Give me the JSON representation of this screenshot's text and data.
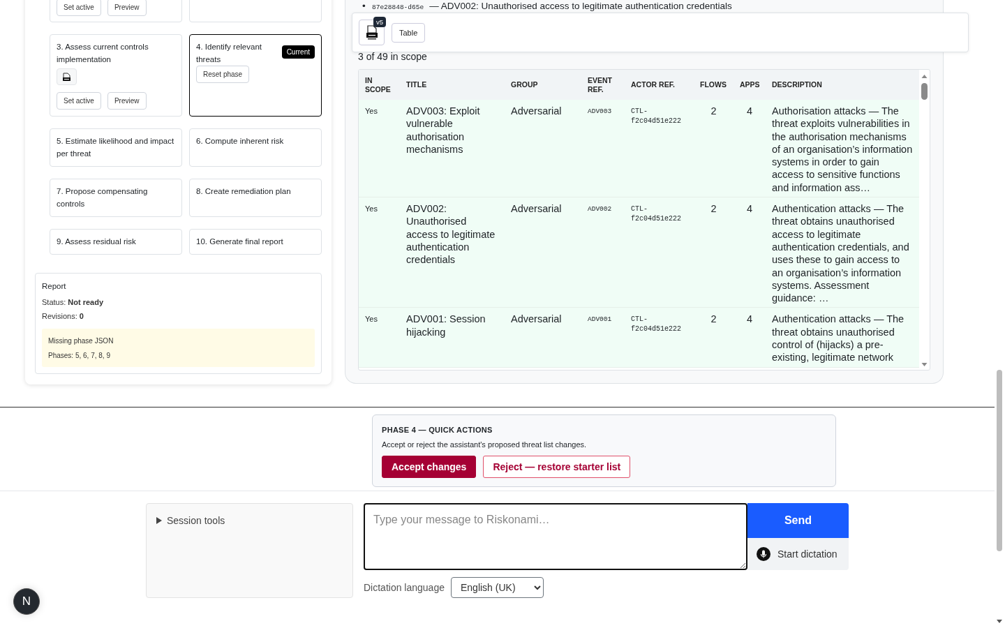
{
  "phases": [
    {
      "kind": "cut",
      "buttons": [
        "Set active",
        "Preview"
      ],
      "current": false
    },
    {
      "kind": "cut",
      "current": false
    },
    {
      "kind": "full",
      "title": "3. Assess current controls implementation",
      "file_icon": true,
      "buttons": [
        "Set active",
        "Preview"
      ],
      "current": false
    },
    {
      "kind": "full",
      "title": "4. Identify relevant threats",
      "badge": "Current",
      "buttons": [
        "Reset phase"
      ],
      "current": true
    },
    {
      "kind": "full",
      "title": "5. Estimate likelihood and impact per threat",
      "current": false
    },
    {
      "kind": "full",
      "title": "6. Compute inherent risk",
      "current": false
    },
    {
      "kind": "full",
      "title": "7. Propose compensating controls",
      "current": false
    },
    {
      "kind": "full",
      "title": "8. Create remediation plan",
      "current": false
    },
    {
      "kind": "full",
      "title": "9. Assess residual risk",
      "current": false
    },
    {
      "kind": "full",
      "title": "10. Generate final report",
      "current": false
    }
  ],
  "report": {
    "title": "Report",
    "status": "Status: **Not ready**",
    "revisions": "Revisions: **0**",
    "warning": {
      "title": "Missing phase JSON",
      "text": "Phases: 5, 6, 7, 8, 9"
    }
  },
  "threats": {
    "bullet": {
      "marker": "•",
      "ref": "87e28848-d65e",
      "text": "— ADV002: Unauthorised access to legitimate authentication credentials"
    },
    "toolbar": {
      "version_badge": "v5",
      "buttons": [
        "Table"
      ]
    },
    "scope_count": "3 of 49 in scope",
    "table": {
      "columns": [
        "IN SCOPE",
        "TITLE",
        "GROUP",
        "EVENT REF.",
        "ACTOR REF.",
        "FLOWS",
        "APPS",
        "DESCRIPTION"
      ],
      "rows": [
        {
          "in_scope": "Yes",
          "title": "ADV003: Exploit vulnerable authorisation mechanisms",
          "group": "Adversarial",
          "event_ref": "ADV003",
          "actor_ref": "CTL-f2c04d51e222",
          "flows": "2",
          "apps": "4",
          "description": "Authorisation attacks — The threat exploits vulnerabilities in the authorisation mechanisms of an organisation’s information systems in order to gain access to sensitive functions and information ass…"
        },
        {
          "in_scope": "Yes",
          "title": "ADV002: Unauthorised access to legitimate authentication credentials",
          "group": "Adversarial",
          "event_ref": "ADV002",
          "actor_ref": "CTL-f2c04d51e222",
          "flows": "2",
          "apps": "4",
          "description": "Authentication attacks — The threat obtains unauthorised access to legitimate authentication credentials, and uses these to gain access to an organisation’s information systems. Assessment guidance: …"
        },
        {
          "in_scope": "Yes",
          "title": "ADV001: Session hijacking",
          "group": "Adversarial",
          "event_ref": "ADV001",
          "actor_ref": "CTL-f2c04d51e222",
          "flows": "2",
          "apps": "4",
          "description": "Authentication attacks — The threat obtains unauthorised control of (hijacks) a pre-existing, legitimate network"
        }
      ]
    }
  },
  "quick_actions": {
    "title": "PHASE 4 — QUICK ACTIONS",
    "text": "Accept or reject the assistant's proposed threat list changes.",
    "buttons": [
      {
        "label": "Accept changes",
        "kind": "primary"
      },
      {
        "label": "Reject — restore starter list",
        "kind": "secondary"
      }
    ]
  },
  "chat": {
    "session_tools": {
      "label": "Session tools",
      "expanded": false
    },
    "message": {
      "placeholder": "Type your message to Riskonami…"
    },
    "send": "Send",
    "dictation": "Start dictation",
    "language_label": "Dictation language",
    "language": "English (UK)"
  },
  "avatar": "N"
}
